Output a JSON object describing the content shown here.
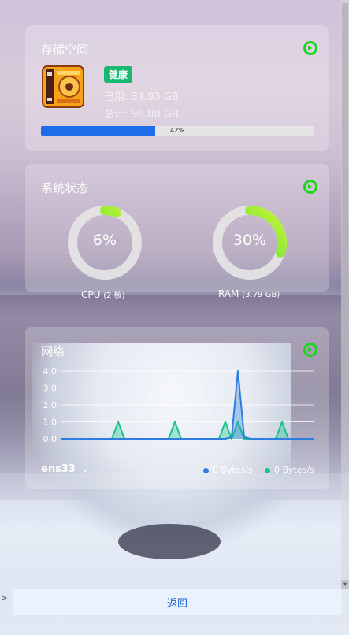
{
  "storage": {
    "title": "存储空间",
    "health": "健康",
    "used": "已用: 34.93 GB",
    "total": "总计: 96.88 GB",
    "percent": 42,
    "percent_label": "42%"
  },
  "system": {
    "title": "系统状态",
    "cpu": {
      "percent": 6,
      "value_label": "6%",
      "name": "CPU",
      "detail": "(2 核)"
    },
    "ram": {
      "percent": 30,
      "value_label": "30%",
      "name": "RAM",
      "detail": "(3.79 GB)"
    }
  },
  "network": {
    "title": "网络",
    "interface": "ens33",
    "y_ticks": [
      "4.0",
      "3.0",
      "2.0",
      "1.0",
      "0.0"
    ],
    "upload_label": "0 Bytes/s",
    "download_label": "0 Bytes/s",
    "colors": {
      "upload": "#2f7de1",
      "download": "#19c48a"
    }
  },
  "chart_data": {
    "type": "area",
    "ylim": [
      0,
      4
    ],
    "y_ticks": [
      0,
      1,
      2,
      3,
      4
    ],
    "x": [
      0,
      1,
      2,
      3,
      4,
      5,
      6,
      7,
      8,
      9,
      10,
      11,
      12,
      13,
      14,
      15,
      16,
      17,
      18,
      19,
      20,
      21,
      22,
      23,
      24,
      25,
      26,
      27,
      28,
      29,
      30,
      31,
      32,
      33,
      34,
      35,
      36,
      37,
      38,
      39,
      40
    ],
    "series": [
      {
        "name": "upload",
        "values": [
          0,
          0,
          0,
          0,
          0,
          0,
          0,
          0,
          0,
          0,
          0,
          0,
          0,
          0,
          0,
          0,
          0,
          0,
          0,
          0,
          0,
          0,
          0,
          0,
          0,
          0,
          0,
          0.1,
          4.0,
          0.1,
          0,
          0,
          0,
          0,
          0,
          0,
          0,
          0,
          0,
          0,
          0
        ]
      },
      {
        "name": "download",
        "values": [
          0,
          0,
          0,
          0,
          0,
          0,
          0,
          0,
          0,
          1.0,
          0,
          0,
          0,
          0,
          0,
          0,
          0,
          0,
          1.0,
          0,
          0,
          0,
          0,
          0,
          0,
          0,
          1.0,
          0,
          1.0,
          0,
          0,
          0,
          0,
          0,
          0,
          1.0,
          0,
          0,
          0,
          0,
          0
        ]
      }
    ]
  },
  "footer": {
    "back_label": "返回",
    "side_marker": ">"
  }
}
